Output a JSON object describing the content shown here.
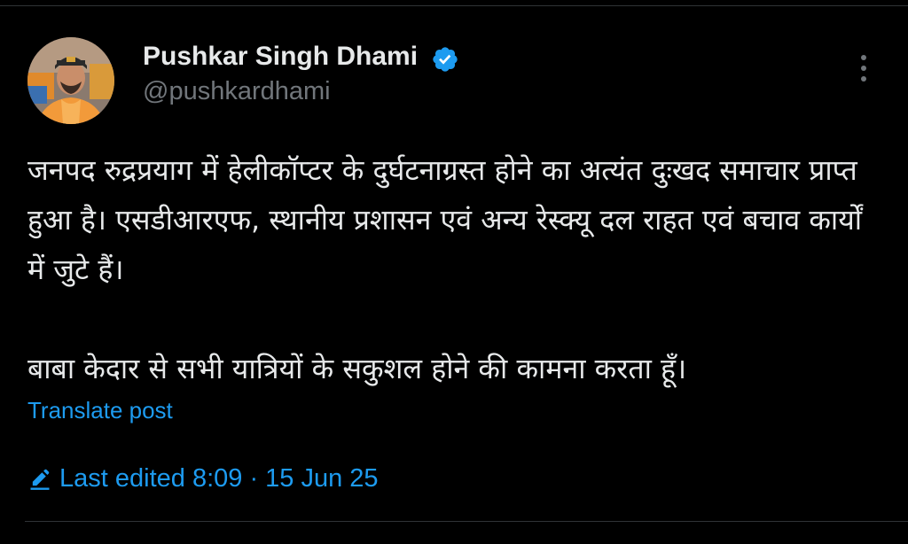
{
  "author": {
    "name": "Pushkar Singh Dhami",
    "handle": "@pushkardhami",
    "verified": true
  },
  "tweet": {
    "paragraphs": [
      "जनपद रुद्रप्रयाग में हेलीकॉप्टर के दुर्घटनाग्रस्त होने का अत्यंत दुःखद समाचार प्राप्त हुआ है। एसडीआरएफ, स्थानीय प्रशासन एवं अन्य रेस्क्यू दल राहत एवं बचाव कार्यों में जुटे हैं।",
      "बाबा केदार से सभी यात्रियों के सकुशल होने की कामना करता हूँ।"
    ],
    "translate_label": "Translate post",
    "edited_label": "Last edited 8:09 · 15 Jun 25"
  },
  "icons": {
    "verified": "verified-badge-icon",
    "more": "more-options-icon",
    "edit": "pencil-icon"
  },
  "colors": {
    "background": "#000000",
    "text_primary": "#e7e9ea",
    "text_secondary": "#71767b",
    "accent": "#1d9bf0",
    "divider": "#2f3336"
  }
}
